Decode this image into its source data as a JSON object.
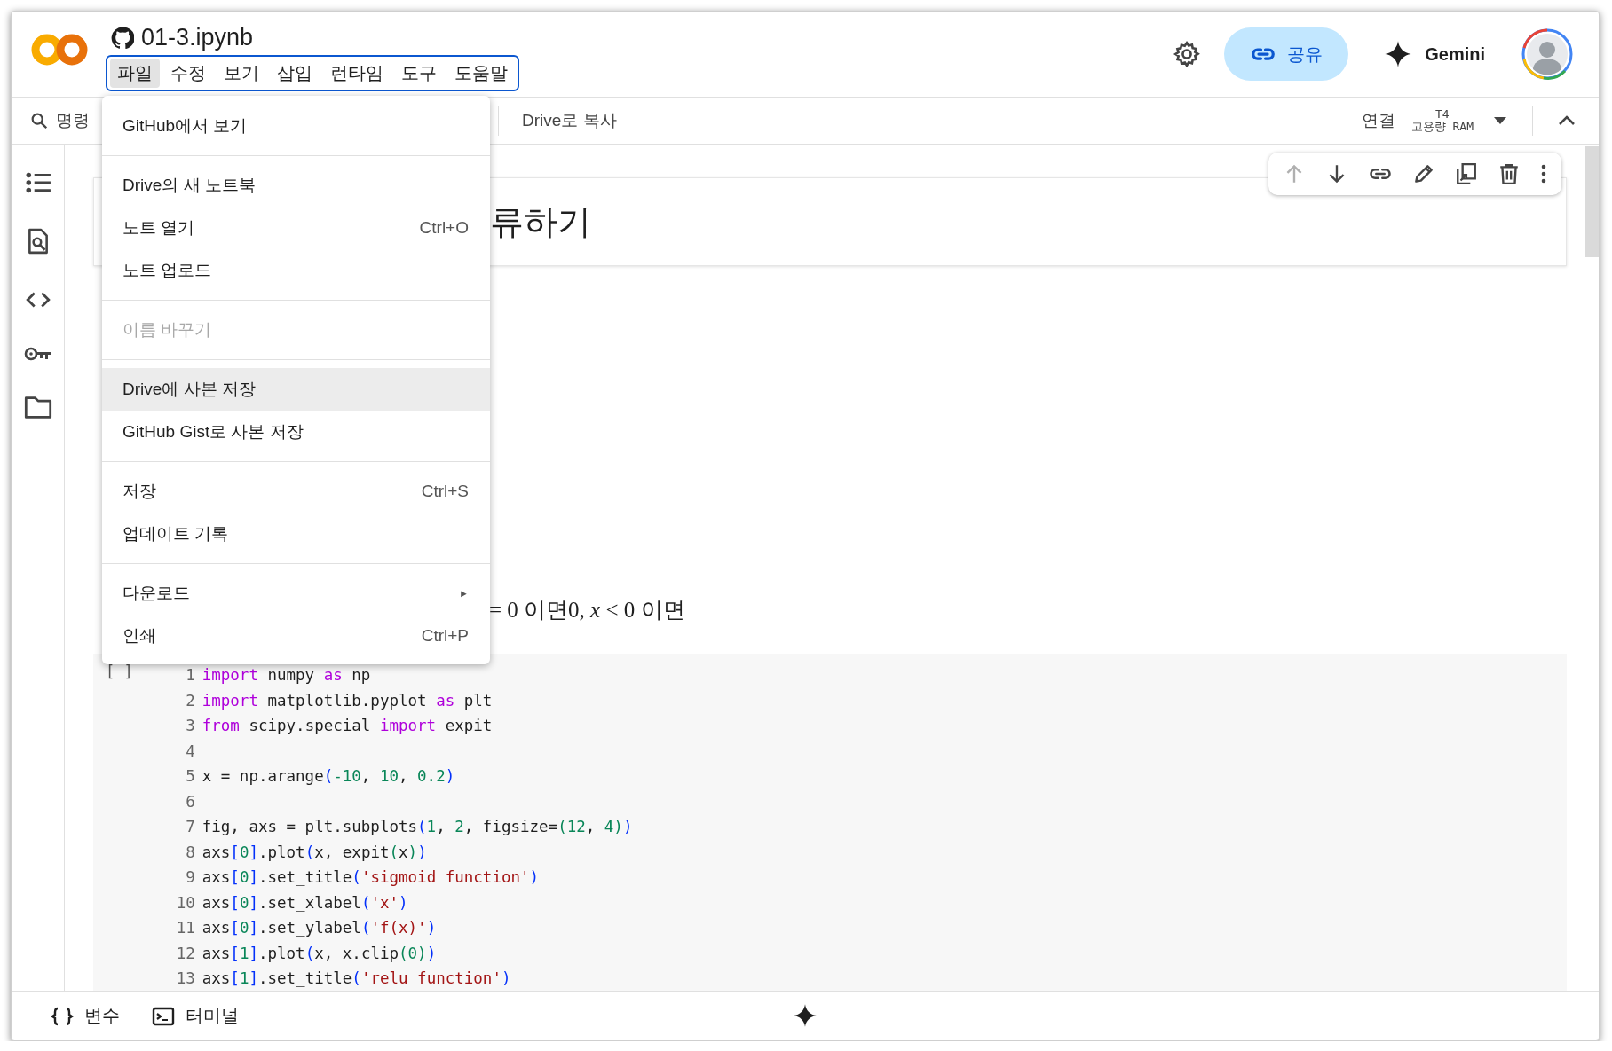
{
  "app": {
    "title": "01-3.ipynb"
  },
  "menu_bar": [
    {
      "label": "파일",
      "selected": true
    },
    {
      "label": "수정",
      "selected": false
    },
    {
      "label": "보기",
      "selected": false
    },
    {
      "label": "삽입",
      "selected": false
    },
    {
      "label": "런타임",
      "selected": false
    },
    {
      "label": "도구",
      "selected": false
    },
    {
      "label": "도움말",
      "selected": false
    }
  ],
  "header_actions": {
    "share_button": "공유",
    "gemini_button": "Gemini"
  },
  "toolbar": {
    "search": "명령",
    "copy_to_drive": "Drive로 복사",
    "connect": "연결",
    "runtime_type": "T4",
    "runtime_ram": "고용량 RAM"
  },
  "file_menu": {
    "groups": [
      [
        {
          "label": "GitHub에서 보기",
          "highlighted": false,
          "disabled": false
        }
      ],
      [
        {
          "label": "Drive의 새 노트북",
          "highlighted": false,
          "disabled": false
        },
        {
          "label": "노트 열기",
          "shortcut": "Ctrl+O",
          "highlighted": false,
          "disabled": false
        },
        {
          "label": "노트 업로드",
          "highlighted": false,
          "disabled": false
        }
      ],
      [
        {
          "label": "이름 바꾸기",
          "highlighted": false,
          "disabled": true
        }
      ],
      [
        {
          "label": "Drive에 사본 저장",
          "highlighted": true,
          "disabled": false
        },
        {
          "label": "GitHub Gist로 사본 저장",
          "highlighted": false,
          "disabled": false
        }
      ],
      [
        {
          "label": "저장",
          "shortcut": "Ctrl+S",
          "highlighted": false,
          "disabled": false
        },
        {
          "label": "업데이트 기록",
          "highlighted": false,
          "disabled": false
        }
      ],
      [
        {
          "label": "다운로드",
          "submenu_arrow": "►",
          "highlighted": false,
          "disabled": false
        },
        {
          "label": "인쇄",
          "shortcut": "Ctrl+P",
          "highlighted": false,
          "disabled": false
        }
      ]
    ]
  },
  "cell_toolbar": {
    "move_up_disabled": true
  },
  "text_cells": {
    "heading": "류하기",
    "formula": "= 0 이면0, *x* < 0 이면"
  },
  "code_cell": {
    "run_marker": "[ ]",
    "lines": [
      {
        "number": "1",
        "tokens": [
          {
            "kind": "keyword",
            "text": "import"
          },
          {
            "kind": "plain",
            "text": " numpy "
          },
          {
            "kind": "keyword",
            "text": "as"
          },
          {
            "kind": "plain",
            "text": " np"
          }
        ]
      },
      {
        "number": "2",
        "tokens": [
          {
            "kind": "keyword",
            "text": "import"
          },
          {
            "kind": "plain",
            "text": " matplotlib.pyplot "
          },
          {
            "kind": "keyword",
            "text": "as"
          },
          {
            "kind": "plain",
            "text": " plt"
          }
        ]
      },
      {
        "number": "3",
        "tokens": [
          {
            "kind": "keyword",
            "text": "from"
          },
          {
            "kind": "plain",
            "text": " scipy.special "
          },
          {
            "kind": "keyword",
            "text": "import"
          },
          {
            "kind": "plain",
            "text": " expit"
          }
        ]
      },
      {
        "number": "4"
      },
      {
        "number": "5",
        "tokens": [
          {
            "kind": "plain",
            "text": "x = np.arange"
          },
          {
            "kind": "bracket",
            "text": "("
          },
          {
            "kind": "number",
            "text": "-10"
          },
          {
            "kind": "plain",
            "text": ", "
          },
          {
            "kind": "number",
            "text": "10"
          },
          {
            "kind": "plain",
            "text": ", "
          },
          {
            "kind": "number",
            "text": "0.2"
          },
          {
            "kind": "bracket",
            "text": ")"
          }
        ]
      },
      {
        "number": "6"
      },
      {
        "number": "7",
        "tokens": [
          {
            "kind": "plain",
            "text": "fig, axs = plt.subplots"
          },
          {
            "kind": "bracket",
            "text": "("
          },
          {
            "kind": "number",
            "text": "1"
          },
          {
            "kind": "plain",
            "text": ", "
          },
          {
            "kind": "number",
            "text": "2"
          },
          {
            "kind": "plain",
            "text": ", figsize="
          },
          {
            "kind": "number",
            "text": "(12"
          },
          {
            "kind": "plain",
            "text": ", "
          },
          {
            "kind": "number",
            "text": "4)"
          },
          {
            "kind": "bracket",
            "text": ")"
          }
        ]
      },
      {
        "number": "8",
        "tokens": [
          {
            "kind": "plain",
            "text": "axs"
          },
          {
            "kind": "bracket",
            "text": "["
          },
          {
            "kind": "number",
            "text": "0"
          },
          {
            "kind": "bracket",
            "text": "]"
          },
          {
            "kind": "plain",
            "text": ".plot"
          },
          {
            "kind": "bracket",
            "text": "("
          },
          {
            "kind": "plain",
            "text": "x, expit"
          },
          {
            "kind": "number",
            "text": "("
          },
          {
            "kind": "plain",
            "text": "x"
          },
          {
            "kind": "number",
            "text": ")"
          },
          {
            "kind": "bracket",
            "text": ")"
          }
        ]
      },
      {
        "number": "9",
        "tokens": [
          {
            "kind": "plain",
            "text": "axs"
          },
          {
            "kind": "bracket",
            "text": "["
          },
          {
            "kind": "number",
            "text": "0"
          },
          {
            "kind": "bracket",
            "text": "]"
          },
          {
            "kind": "plain",
            "text": ".set_title"
          },
          {
            "kind": "bracket",
            "text": "("
          },
          {
            "kind": "string",
            "text": "'sigmoid function'"
          },
          {
            "kind": "bracket",
            "text": ")"
          }
        ]
      },
      {
        "number": "10",
        "tokens": [
          {
            "kind": "plain",
            "text": "axs"
          },
          {
            "kind": "bracket",
            "text": "["
          },
          {
            "kind": "number",
            "text": "0"
          },
          {
            "kind": "bracket",
            "text": "]"
          },
          {
            "kind": "plain",
            "text": ".set_xlabel"
          },
          {
            "kind": "bracket",
            "text": "("
          },
          {
            "kind": "string",
            "text": "'x'"
          },
          {
            "kind": "bracket",
            "text": ")"
          }
        ]
      },
      {
        "number": "11",
        "tokens": [
          {
            "kind": "plain",
            "text": "axs"
          },
          {
            "kind": "bracket",
            "text": "["
          },
          {
            "kind": "number",
            "text": "0"
          },
          {
            "kind": "bracket",
            "text": "]"
          },
          {
            "kind": "plain",
            "text": ".set_ylabel"
          },
          {
            "kind": "bracket",
            "text": "("
          },
          {
            "kind": "string",
            "text": "'f(x)'"
          },
          {
            "kind": "bracket",
            "text": ")"
          }
        ]
      },
      {
        "number": "12",
        "tokens": [
          {
            "kind": "plain",
            "text": "axs"
          },
          {
            "kind": "bracket",
            "text": "["
          },
          {
            "kind": "number",
            "text": "1"
          },
          {
            "kind": "bracket",
            "text": "]"
          },
          {
            "kind": "plain",
            "text": ".plot"
          },
          {
            "kind": "bracket",
            "text": "("
          },
          {
            "kind": "plain",
            "text": "x, x.clip"
          },
          {
            "kind": "number",
            "text": "(0)"
          },
          {
            "kind": "bracket",
            "text": ")"
          }
        ]
      },
      {
        "number": "13",
        "tokens": [
          {
            "kind": "plain",
            "text": "axs"
          },
          {
            "kind": "bracket",
            "text": "["
          },
          {
            "kind": "number",
            "text": "1"
          },
          {
            "kind": "bracket",
            "text": "]"
          },
          {
            "kind": "plain",
            "text": ".set_title"
          },
          {
            "kind": "bracket",
            "text": "("
          },
          {
            "kind": "string",
            "text": "'relu function'"
          },
          {
            "kind": "bracket",
            "text": ")"
          }
        ]
      }
    ]
  },
  "bottom_bar": {
    "variables": "변수",
    "terminal": "터미널"
  }
}
